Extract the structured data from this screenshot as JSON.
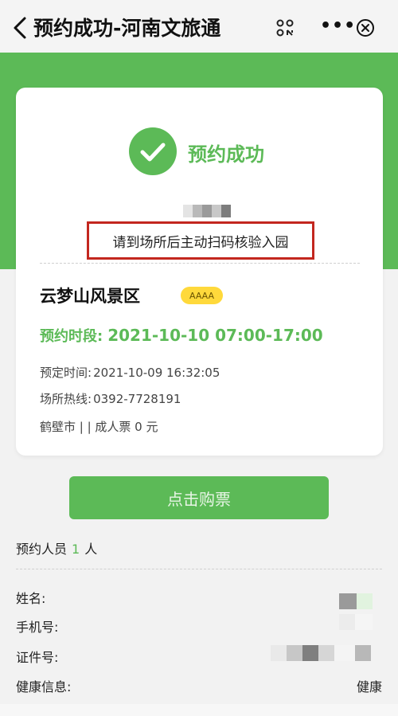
{
  "header": {
    "title": "预约成功-河南文旅通",
    "back_icon": "chevron-left-icon",
    "scan_icon": "scan-icon",
    "more_label": "•••",
    "close_icon": "close-circle-icon"
  },
  "card": {
    "success_label": "预约成功",
    "hint": "请到场所后主动扫码核验入园",
    "venue_name": "云梦山风景区",
    "level_badge": "AAAA",
    "slot_label": "预约时段:",
    "slot_value": "2021-10-10 07:00-17:00",
    "booked_label": "预定时间:",
    "booked_value": "2021-10-09 16:32:05",
    "hotline_label": "场所热线:",
    "hotline_value": "0392-7728191",
    "ticket_info": "鹤壁市 | | 成人票 0 元"
  },
  "buy_button": {
    "label": "点击购票"
  },
  "people": {
    "label": "预约人员",
    "count": "1",
    "unit": "人",
    "fields": [
      {
        "label": "姓名:",
        "value": ""
      },
      {
        "label": "手机号:",
        "value": ""
      },
      {
        "label": "证件号:",
        "value": ""
      },
      {
        "label": "健康信息:",
        "value": "健康"
      }
    ]
  },
  "colors": {
    "accent": "#5cba57",
    "highlight_border": "#c3271f",
    "badge": "#ffd93b"
  }
}
